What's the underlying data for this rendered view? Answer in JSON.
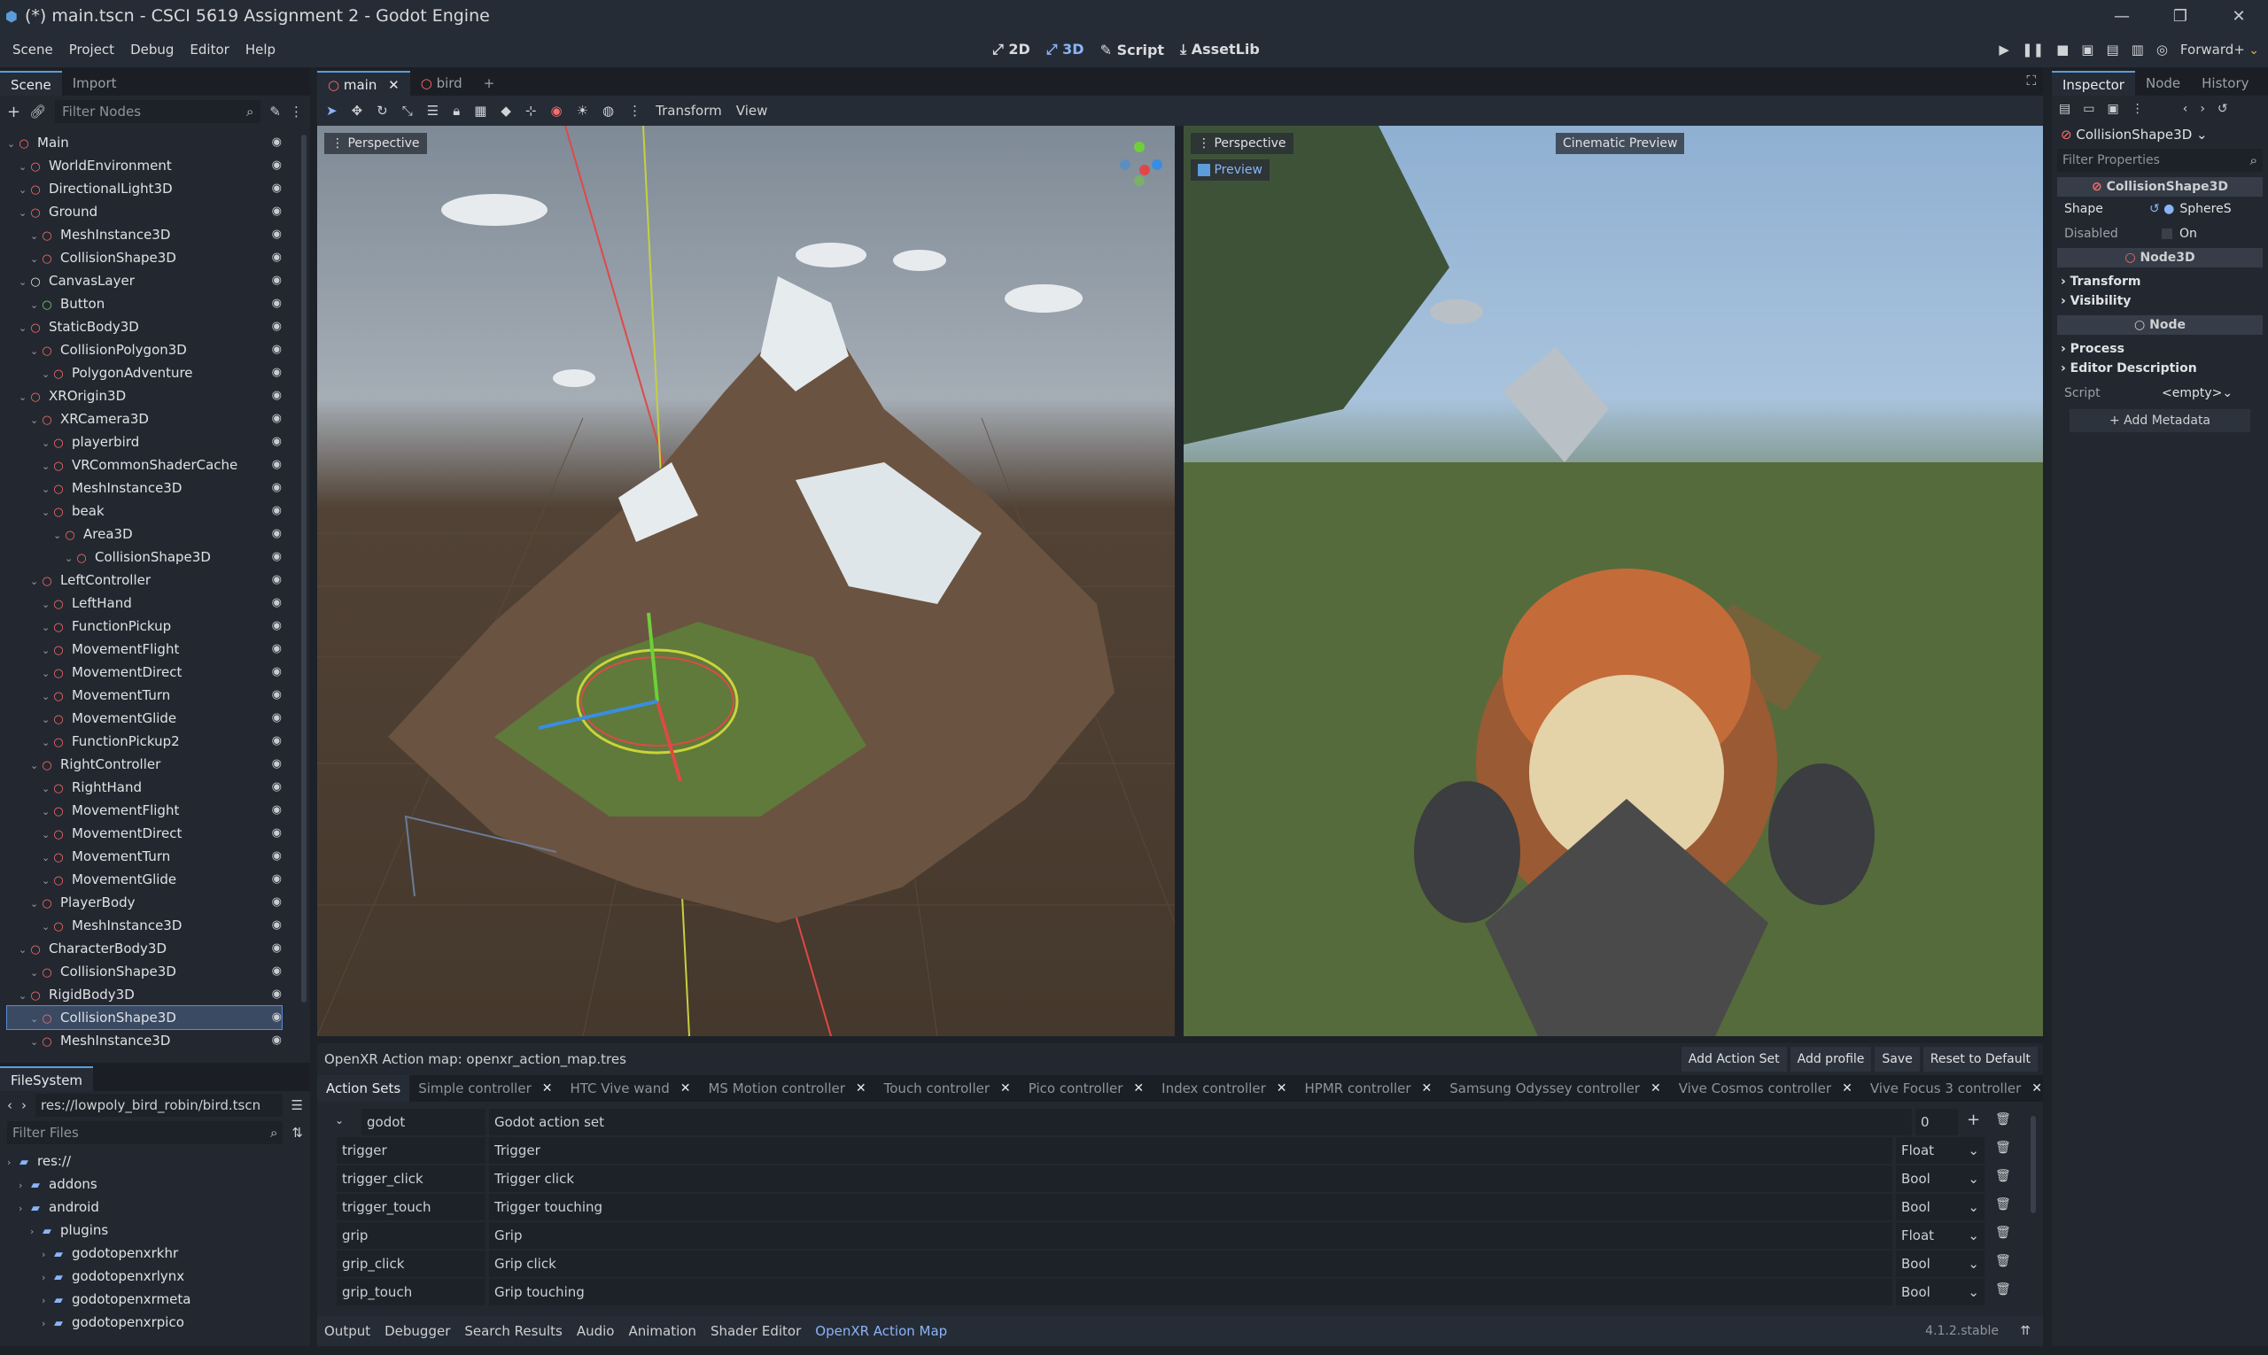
{
  "window": {
    "title": "(*) main.tscn - CSCI 5619 Assignment 2 - Godot Engine"
  },
  "menu": [
    "Scene",
    "Project",
    "Debug",
    "Editor",
    "Help"
  ],
  "modes": {
    "m2d": "2D",
    "m3d": "3D",
    "script": "Script",
    "assetlib": "AssetLib"
  },
  "renderer": "Forward+",
  "scene_dock": {
    "tabs": [
      "Scene",
      "Import"
    ],
    "filter_placeholder": "Filter Nodes",
    "nodes": [
      {
        "label": "Main",
        "depth": 0,
        "color": "#ff6b6b"
      },
      {
        "label": "WorldEnvironment",
        "depth": 1,
        "color": "#ff6b6b"
      },
      {
        "label": "DirectionalLight3D",
        "depth": 1,
        "color": "#ff6b6b"
      },
      {
        "label": "Ground",
        "depth": 1,
        "color": "#ff6b6b"
      },
      {
        "label": "MeshInstance3D",
        "depth": 2,
        "color": "#ff6b6b"
      },
      {
        "label": "CollisionShape3D",
        "depth": 2,
        "color": "#ff6b6b"
      },
      {
        "label": "CanvasLayer",
        "depth": 1,
        "color": "#dfe1e4"
      },
      {
        "label": "Button",
        "depth": 2,
        "color": "#7bd36b"
      },
      {
        "label": "StaticBody3D",
        "depth": 1,
        "color": "#ff6b6b"
      },
      {
        "label": "CollisionPolygon3D",
        "depth": 2,
        "color": "#ff6b6b"
      },
      {
        "label": "PolygonAdventure",
        "depth": 3,
        "color": "#ff6b6b"
      },
      {
        "label": "XROrigin3D",
        "depth": 1,
        "color": "#ff6b6b"
      },
      {
        "label": "XRCamera3D",
        "depth": 2,
        "color": "#ff6b6b"
      },
      {
        "label": "playerbird",
        "depth": 3,
        "color": "#ff6b6b"
      },
      {
        "label": "VRCommonShaderCache",
        "depth": 3,
        "color": "#ff6b6b"
      },
      {
        "label": "MeshInstance3D",
        "depth": 3,
        "color": "#ff6b6b"
      },
      {
        "label": "beak",
        "depth": 3,
        "color": "#ff6b6b"
      },
      {
        "label": "Area3D",
        "depth": 4,
        "color": "#ff6b6b"
      },
      {
        "label": "CollisionShape3D",
        "depth": 5,
        "color": "#ff6b6b"
      },
      {
        "label": "LeftController",
        "depth": 2,
        "color": "#ff6b6b"
      },
      {
        "label": "LeftHand",
        "depth": 3,
        "color": "#ff6b6b"
      },
      {
        "label": "FunctionPickup",
        "depth": 3,
        "color": "#ff6b6b"
      },
      {
        "label": "MovementFlight",
        "depth": 3,
        "color": "#ff6b6b"
      },
      {
        "label": "MovementDirect",
        "depth": 3,
        "color": "#ff6b6b"
      },
      {
        "label": "MovementTurn",
        "depth": 3,
        "color": "#ff6b6b"
      },
      {
        "label": "MovementGlide",
        "depth": 3,
        "color": "#ff6b6b"
      },
      {
        "label": "FunctionPickup2",
        "depth": 3,
        "color": "#ff6b6b"
      },
      {
        "label": "RightController",
        "depth": 2,
        "color": "#ff6b6b"
      },
      {
        "label": "RightHand",
        "depth": 3,
        "color": "#ff6b6b"
      },
      {
        "label": "MovementFlight",
        "depth": 3,
        "color": "#ff6b6b"
      },
      {
        "label": "MovementDirect",
        "depth": 3,
        "color": "#ff6b6b"
      },
      {
        "label": "MovementTurn",
        "depth": 3,
        "color": "#ff6b6b"
      },
      {
        "label": "MovementGlide",
        "depth": 3,
        "color": "#ff6b6b"
      },
      {
        "label": "PlayerBody",
        "depth": 2,
        "color": "#ff6b6b"
      },
      {
        "label": "MeshInstance3D",
        "depth": 3,
        "color": "#ff6b6b"
      },
      {
        "label": "CharacterBody3D",
        "depth": 1,
        "color": "#ff6b6b"
      },
      {
        "label": "CollisionShape3D",
        "depth": 2,
        "color": "#ff6b6b"
      },
      {
        "label": "RigidBody3D",
        "depth": 1,
        "color": "#ff6b6b"
      },
      {
        "label": "CollisionShape3D",
        "depth": 2,
        "color": "#ff6b6b",
        "selected": true
      },
      {
        "label": "MeshInstance3D",
        "depth": 2,
        "color": "#ff6b6b"
      }
    ]
  },
  "filesystem": {
    "tab": "FileSystem",
    "path": "res://lowpoly_bird_robin/bird.tscn",
    "filter_placeholder": "Filter Files",
    "items": [
      {
        "label": "res://",
        "depth": 0
      },
      {
        "label": "addons",
        "depth": 1
      },
      {
        "label": "android",
        "depth": 1
      },
      {
        "label": "plugins",
        "depth": 2
      },
      {
        "label": "godotopenxrkhr",
        "depth": 3
      },
      {
        "label": "godotopenxrlynx",
        "depth": 3
      },
      {
        "label": "godotopenxrmeta",
        "depth": 3
      },
      {
        "label": "godotopenxrpico",
        "depth": 3
      }
    ]
  },
  "scene_tabs": [
    "main",
    "bird"
  ],
  "viewport_toolbar": {
    "transform": "Transform",
    "view": "View"
  },
  "viewports": {
    "left_label": "Perspective",
    "right_label": "Perspective",
    "preview": "Preview",
    "cinematic": "Cinematic Preview"
  },
  "inspector": {
    "tabs": [
      "Inspector",
      "Node",
      "History"
    ],
    "object": "CollisionShape3D",
    "filter_placeholder": "Filter Properties",
    "class_header": "CollisionShape3D",
    "shape_label": "Shape",
    "shape_value": "SphereS",
    "disabled_label": "Disabled",
    "disabled_value": "On",
    "node3d_header": "Node3D",
    "transform": "Transform",
    "visibility": "Visibility",
    "node_header": "Node",
    "process": "Process",
    "editor_description": "Editor Description",
    "script_label": "Script",
    "script_value": "<empty>",
    "add_metadata": "Add Metadata"
  },
  "openxr": {
    "title": "OpenXR Action map: openxr_action_map.tres",
    "buttons": [
      "Add Action Set",
      "Add profile",
      "Save",
      "Reset to Default"
    ],
    "tabs": [
      "Action Sets",
      "Simple controller",
      "HTC Vive wand",
      "MS Motion controller",
      "Touch controller",
      "Pico controller",
      "Index controller",
      "HPMR controller",
      "Samsung Odyssey controller",
      "Vive Cosmos controller",
      "Vive Focus 3 controller"
    ],
    "set": {
      "name": "godot",
      "desc": "Godot action set",
      "priority": "0"
    },
    "actions": [
      {
        "name": "trigger",
        "desc": "Trigger",
        "type": "Float"
      },
      {
        "name": "trigger_click",
        "desc": "Trigger click",
        "type": "Bool"
      },
      {
        "name": "trigger_touch",
        "desc": "Trigger touching",
        "type": "Bool"
      },
      {
        "name": "grip",
        "desc": "Grip",
        "type": "Float"
      },
      {
        "name": "grip_click",
        "desc": "Grip click",
        "type": "Bool"
      },
      {
        "name": "grip_touch",
        "desc": "Grip touching",
        "type": "Bool"
      }
    ]
  },
  "bottom_tabs": [
    "Output",
    "Debugger",
    "Search Results",
    "Audio",
    "Animation",
    "Shader Editor",
    "OpenXR Action Map"
  ],
  "version": "4.1.2.stable"
}
